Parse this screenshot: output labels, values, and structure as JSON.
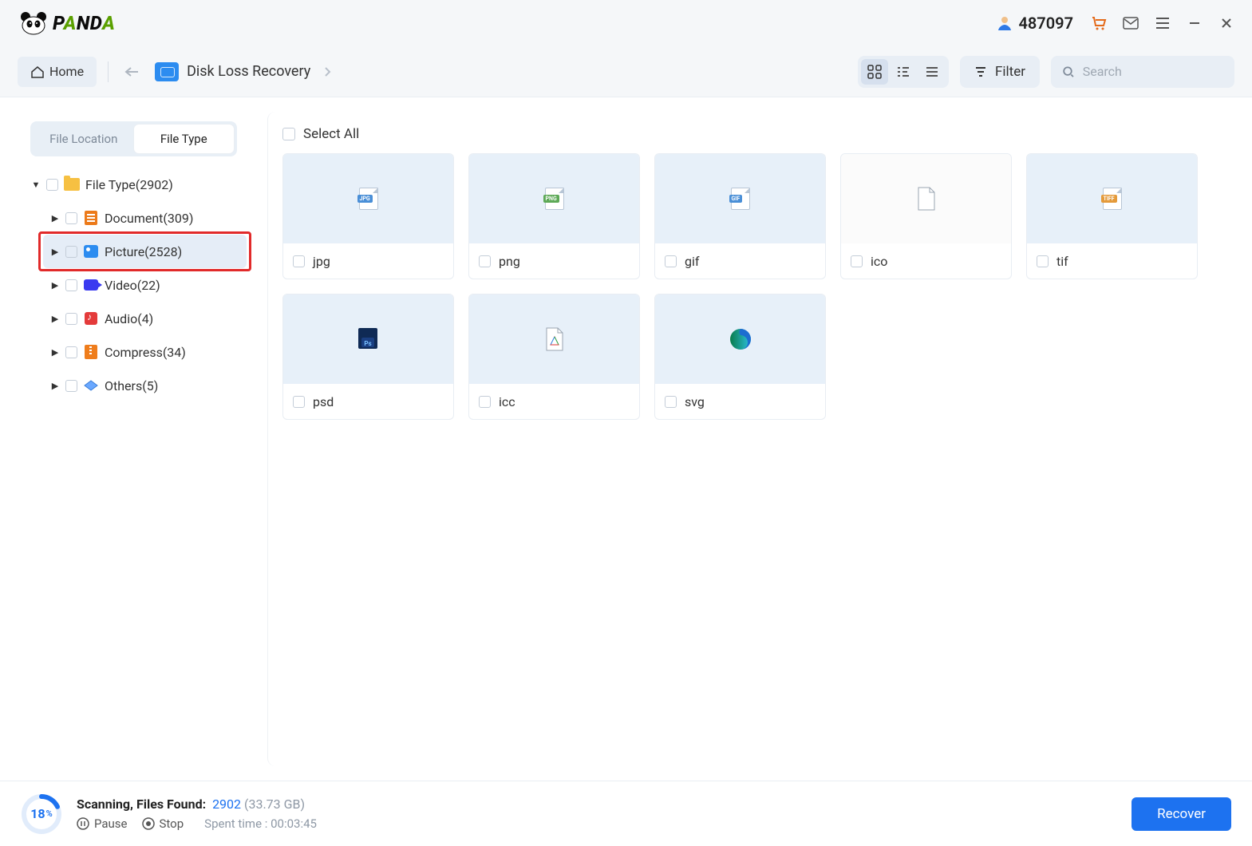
{
  "brand": {
    "name": "PANDA"
  },
  "titlebar": {
    "user_number": "487097"
  },
  "toolbar": {
    "home_label": "Home",
    "breadcrumb": "Disk Loss Recovery",
    "filter_label": "Filter",
    "search_placeholder": "Search"
  },
  "sidebar": {
    "tabs": {
      "location": "File Location",
      "type": "File Type"
    },
    "root": {
      "label": "File Type(2902)"
    },
    "items": [
      {
        "label": "Document(309)"
      },
      {
        "label": "Picture(2528)"
      },
      {
        "label": "Video(22)"
      },
      {
        "label": "Audio(4)"
      },
      {
        "label": "Compress(34)"
      },
      {
        "label": "Others(5)"
      }
    ]
  },
  "content": {
    "select_all": "Select All",
    "items": [
      {
        "label": "jpg",
        "tag": "JPG",
        "tag_color": "#4a8fd7",
        "plain": false
      },
      {
        "label": "png",
        "tag": "PNG",
        "tag_color": "#5da957",
        "plain": false
      },
      {
        "label": "gif",
        "tag": "GIF",
        "tag_color": "#4a8fd7",
        "plain": false
      },
      {
        "label": "ico",
        "tag": "",
        "tag_color": "",
        "plain": true
      },
      {
        "label": "tif",
        "tag": "TIFF",
        "tag_color": "#e49a3a",
        "plain": false
      },
      {
        "label": "psd",
        "tag": "PSD",
        "tag_color": "#1a2f63",
        "plain": false
      },
      {
        "label": "icc",
        "tag": "",
        "tag_color": "",
        "plain": false
      },
      {
        "label": "svg",
        "tag": "",
        "tag_color": "",
        "plain": false
      }
    ]
  },
  "footer": {
    "progress_pct": "18",
    "progress_pct_sign": "%",
    "status_label": "Scanning, Files Found:",
    "found_count": "2902",
    "found_size": "(33.73 GB)",
    "pause": "Pause",
    "stop": "Stop",
    "spent_time": "Spent time : 00:03:45",
    "recover": "Recover"
  }
}
